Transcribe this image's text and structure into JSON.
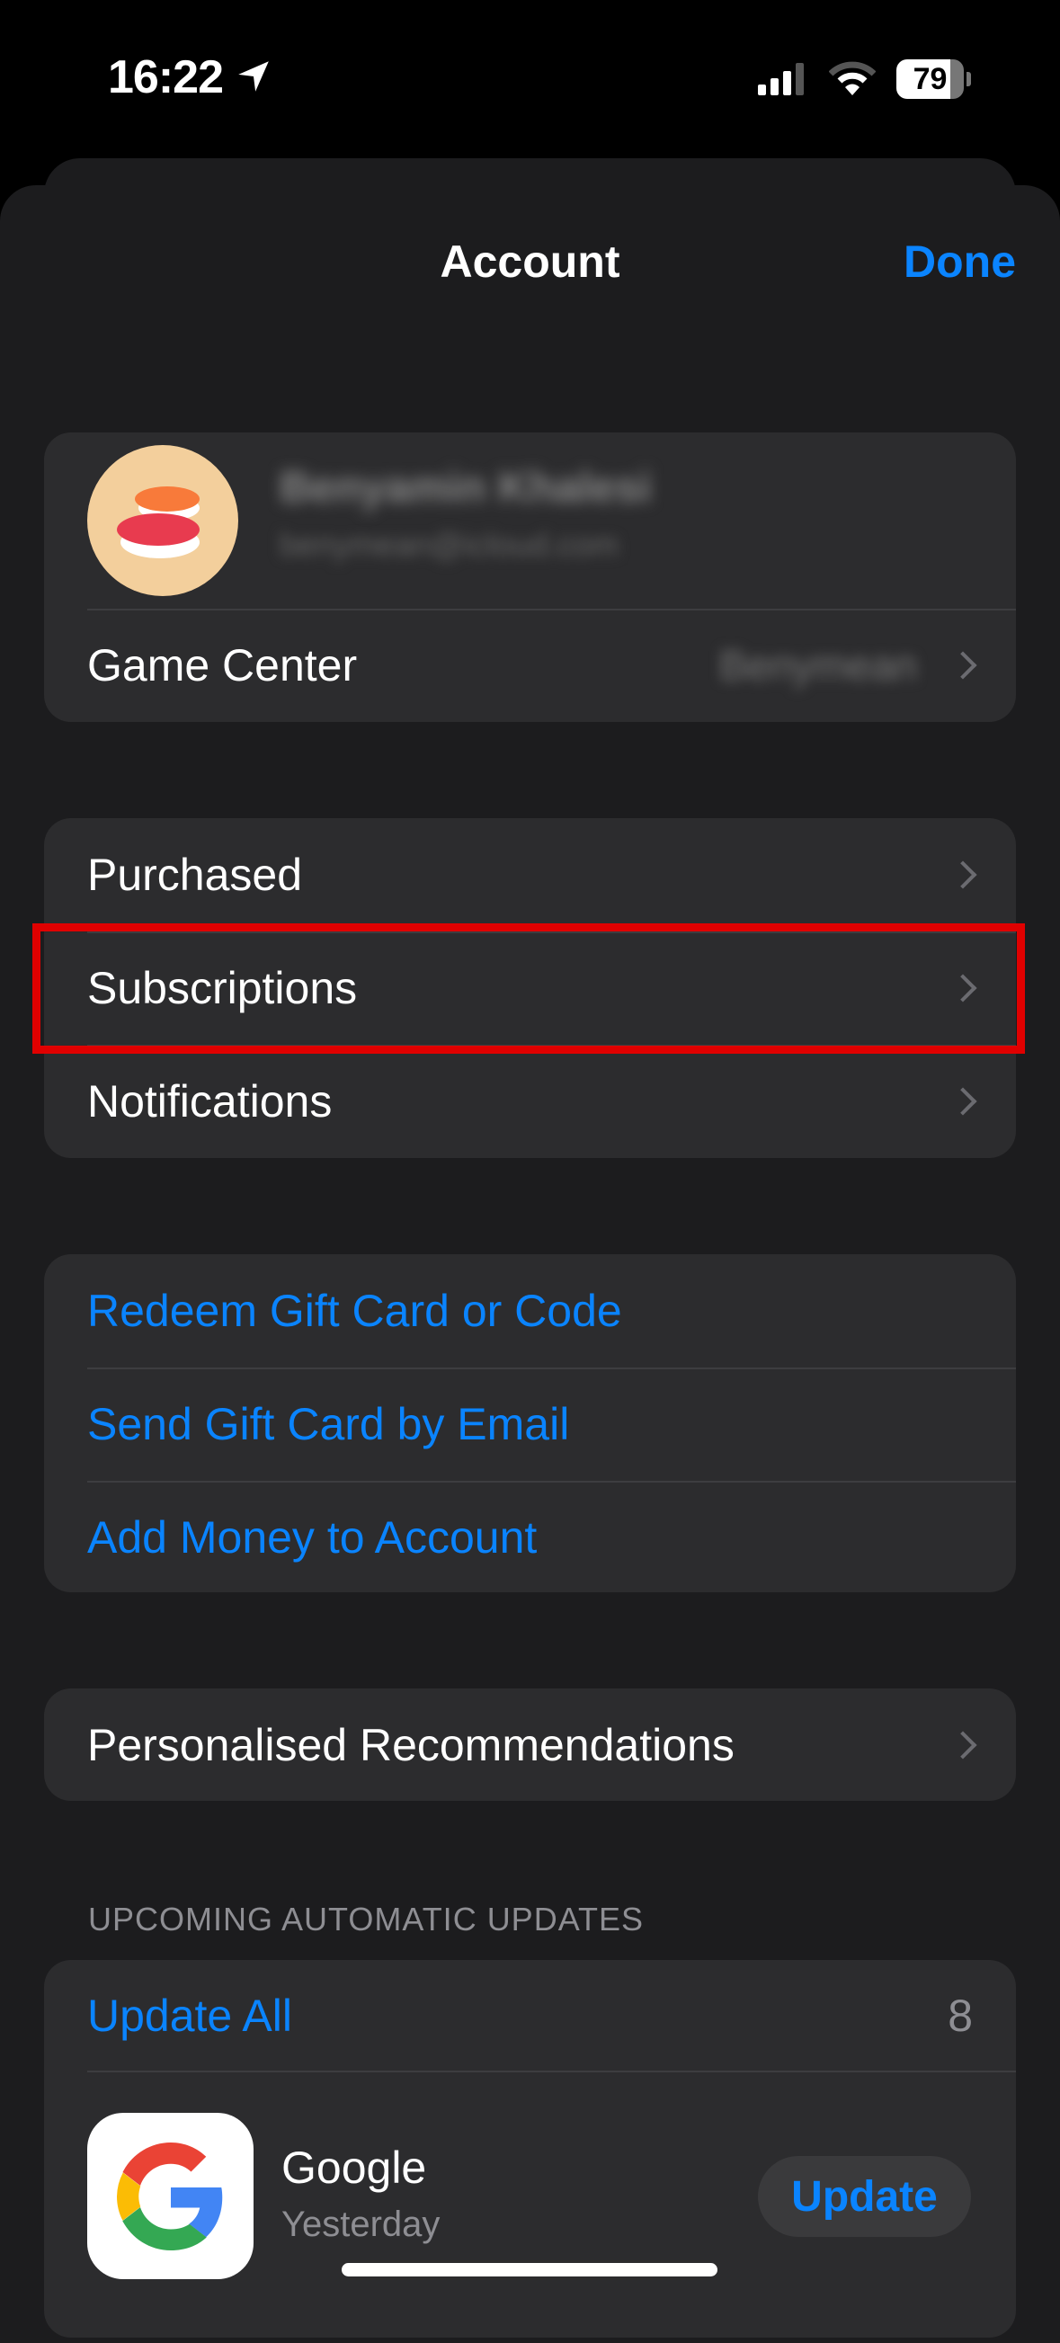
{
  "status": {
    "time": "16:22",
    "battery": "79"
  },
  "header": {
    "title": "Account",
    "done_label": "Done"
  },
  "profile": {
    "name": "Benyamin Khalesi",
    "email": "benymean@icloud.com",
    "game_center_label": "Game Center",
    "game_center_value": "Benymean"
  },
  "menu": [
    {
      "label": "Purchased"
    },
    {
      "label": "Subscriptions",
      "highlighted": true
    },
    {
      "label": "Notifications"
    }
  ],
  "gift": [
    {
      "label": "Redeem Gift Card or Code"
    },
    {
      "label": "Send Gift Card by Email"
    },
    {
      "label": "Add Money to Account"
    }
  ],
  "recommendations": {
    "label": "Personalised Recommendations"
  },
  "updates": {
    "section_title": "UPCOMING AUTOMATIC UPDATES",
    "update_all_label": "Update All",
    "count": "8",
    "apps": [
      {
        "name": "Google",
        "date": "Yesterday",
        "button": "Update"
      }
    ]
  },
  "colors": {
    "accent": "#0a84ff",
    "highlight": "#e00000"
  }
}
